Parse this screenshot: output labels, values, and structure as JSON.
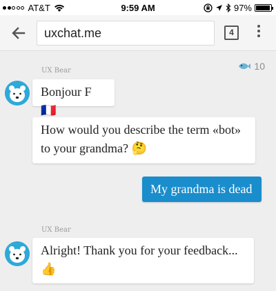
{
  "status_bar": {
    "carrier": "AT&T",
    "time": "9:59 AM",
    "battery": "97%",
    "battery_level": 0.97,
    "signal_bars_filled": 2,
    "signal_bars_total": 5
  },
  "browser": {
    "url": "uxchat.me",
    "tab_count": "4"
  },
  "chat": {
    "counter_value": "10",
    "messages": [
      {
        "sender": "UX Bear",
        "text": "Bonjour F🇫🇷"
      },
      {
        "text": "How would you describe the term «bot» to your grandma? 🤔"
      },
      {
        "from": "user",
        "text": "My grandma is dead"
      },
      {
        "sender": "UX Bear",
        "text": "Alright! Thank you for your feedback... 👍"
      }
    ]
  },
  "colors": {
    "accent": "#1a8dcc",
    "avatar_bg": "#2ea9d9",
    "background": "#eeeeee"
  }
}
